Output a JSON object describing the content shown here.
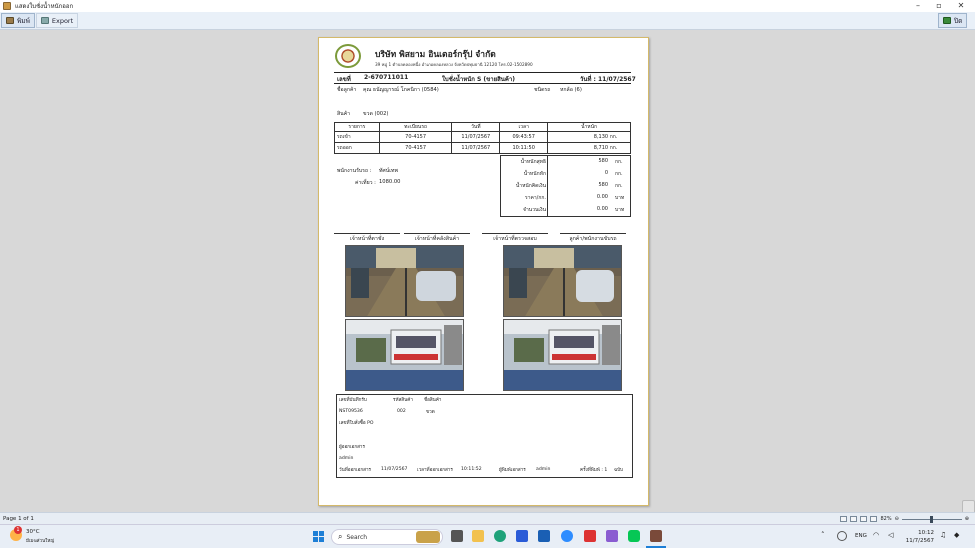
{
  "window": {
    "title": "แสดงใบชั่งน้ำหนักออก"
  },
  "toolbar": {
    "print_label": "พิมพ์",
    "export_label": "Export",
    "close_label": "ปิด"
  },
  "report": {
    "company": "บริษัท พิสยาม อินเตอร์กรุ๊ป จำกัด",
    "address": "39 หมู่ 1 ตำบลคลองหนึ่ง อำเภอคลองหลวง จังหวัดปทุมธานี 12120 โทร.02-1502890",
    "doc_no_label": "เลขที่",
    "doc_no": "2-670711011",
    "doc_title": "ใบชั่งน้ำหนัก S (ขายสินค้า)",
    "date_label": "วันที่ : 11/07/2567",
    "customer_label": "ชื่อลูกค้า",
    "customer": "คุณ ธนัญญารณ์ โภคนิกา (0584)",
    "car_type_label": "ชนิดรถ",
    "car_type": "หกล้อ (6)",
    "product_label": "สินค้า",
    "product": "ขวด (002)",
    "table_headers": [
      "รายการ",
      "ทะเบียนรถ",
      "วันที่",
      "เวลา",
      "น้ำหนัก"
    ],
    "rows": [
      {
        "item": "รถเข้า",
        "plate": "70-4157",
        "date": "11/07/2567",
        "time": "09:43:57",
        "weight": "8,130",
        "unit": "กก."
      },
      {
        "item": "รถออก",
        "plate": "70-4157",
        "date": "11/07/2567",
        "time": "10:11:50",
        "weight": "8,710",
        "unit": "กก."
      }
    ],
    "employee_label": "พนักงานรับรถ :",
    "employee": "ทัศน์เทพ",
    "fee_label": "ค่าเที่ยว :",
    "fee": "1080.00",
    "summary": [
      {
        "label": "น้ำหนักสุทธิ",
        "value": "580",
        "unit": "กก."
      },
      {
        "label": "น้ำหนักหัก",
        "value": "0",
        "unit": "กก."
      },
      {
        "label": "น้ำหนักคิดเงิน",
        "value": "580",
        "unit": "กก."
      },
      {
        "label": "ราคา/กก.",
        "value": "0.00",
        "unit": "บาท"
      },
      {
        "label": "จำนวนเงิน",
        "value": "0.00",
        "unit": "บาท"
      }
    ],
    "signatures": [
      "เจ้าหน้าที่ตาชั่ง",
      "เจ้าหน้าที่คลังสินค้า",
      "เจ้าหน้าที่ตรวจสอบ",
      "ลูกค้า/พนักงานขับรถ"
    ],
    "bottom": {
      "ref_label": "เลขที่บันทึกรับ",
      "code_label": "รหัสสินค้า",
      "name_label": "ชื่อสินค้า",
      "ref_value": "NST09536",
      "code_value": "002",
      "name_value": "ขวด",
      "po_label": "เลขที่ใบสั่งซื้อ PO",
      "recorder_label": "ผู้ออกเอกสาร",
      "recorder": "admin",
      "doc_date_label": "วันที่ออกเอกสาร",
      "doc_date": "11/07/2567",
      "doc_time_label": "เวลาที่ออกเอกสาร",
      "doc_time": "10:11:52",
      "printer_label": "ผู้พิมพ์เอกสาร",
      "printer": "admin",
      "copies_label": "ครั้งที่พิมพ์ : 1",
      "copy_type": "ฉบับ"
    }
  },
  "status": {
    "page": "Page 1 of 1",
    "zoom": "82%"
  },
  "taskbar": {
    "weather_temp": "30°C",
    "weather_desc": "มีเมฆส่วนใหญ่",
    "weather_badge": "1",
    "search_placeholder": "Search",
    "lang": "ENG",
    "time": "10:12",
    "date": "11/7/2567"
  }
}
